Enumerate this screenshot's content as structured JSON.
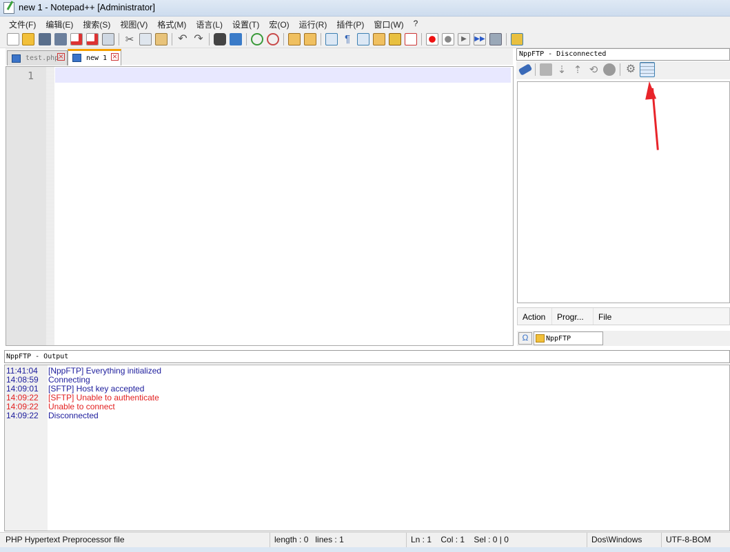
{
  "window": {
    "title": "new 1 - Notepad++ [Administrator]"
  },
  "menu": [
    "文件(F)",
    "编辑(E)",
    "搜索(S)",
    "视图(V)",
    "格式(M)",
    "语言(L)",
    "设置(T)",
    "宏(O)",
    "运行(R)",
    "插件(P)",
    "窗口(W)",
    "?"
  ],
  "toolbar_icons": [
    "new-file",
    "open-file",
    "save",
    "save-all",
    "close",
    "close-all",
    "print",
    "cut",
    "copy",
    "paste",
    "undo",
    "redo",
    "find",
    "replace",
    "zoom-in",
    "zoom-out",
    "sync-vertical",
    "sync-horizontal",
    "word-wrap",
    "show-all-chars",
    "indent-guide",
    "doc-map",
    "function-list",
    "folder-workspace",
    "record-macro",
    "stop-macro",
    "play-macro",
    "run-macro-multiple",
    "save-macro",
    "nppftp"
  ],
  "tabs": [
    {
      "label": "test.php",
      "active": false
    },
    {
      "label": "new 1",
      "active": true
    }
  ],
  "editor": {
    "line_numbers": [
      "1"
    ]
  },
  "nppftp": {
    "title": "NppFTP - Disconnected",
    "toolbar_icons": [
      "connect",
      "download",
      "upload",
      "refresh",
      "abort",
      "settings",
      "message-window"
    ],
    "queue_columns": [
      "Action",
      "Progr...",
      "File"
    ],
    "bottom_tab": "NppFTP"
  },
  "output": {
    "title": "NppFTP - Output",
    "lines": [
      {
        "time": "11:41:04",
        "msg": "[NppFTP] Everything initialized",
        "level": "info"
      },
      {
        "time": "14:08:59",
        "msg": "Connecting",
        "level": "info"
      },
      {
        "time": "14:09:01",
        "msg": "[SFTP] Host key accepted",
        "level": "info"
      },
      {
        "time": "14:09:22",
        "msg": "[SFTP] Unable to authenticate",
        "level": "error"
      },
      {
        "time": "14:09:22",
        "msg": "Unable to connect",
        "level": "error"
      },
      {
        "time": "14:09:22",
        "msg": "Disconnected",
        "level": "info"
      }
    ]
  },
  "status": {
    "filetype": "PHP Hypertext Preprocessor file",
    "length": "length : 0",
    "lines": "lines : 1",
    "ln": "Ln : 1",
    "col": "Col : 1",
    "sel": "Sel : 0 | 0",
    "eol": "Dos\\Windows",
    "encoding": "UTF-8-BOM"
  },
  "colors": {
    "info": "#1c1c9c",
    "error": "#e22020",
    "annotation": "#e8242a",
    "tab_accent": "#f5a000"
  }
}
